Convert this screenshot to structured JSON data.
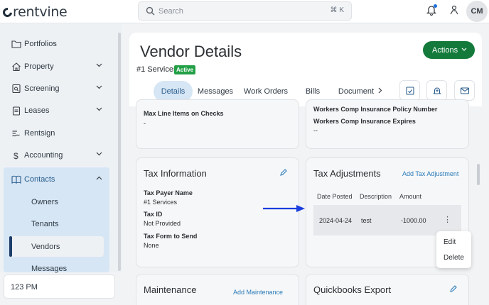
{
  "topbar": {
    "logo_text": "rentvine",
    "search_placeholder": "Search",
    "search_shortcut": "⌘ K",
    "avatar_initials": "CM",
    "icons": [
      "bell-icon",
      "user-icon"
    ],
    "notification_dot_color": "#1e6fd9"
  },
  "sidebar": {
    "items": [
      {
        "label": "Portfolios",
        "icon": "folder-icon",
        "expandable": false
      },
      {
        "label": "Property",
        "icon": "house-icon",
        "expandable": true
      },
      {
        "label": "Screening",
        "icon": "screening-icon",
        "expandable": true
      },
      {
        "label": "Leases",
        "icon": "clipboard-icon",
        "expandable": true
      },
      {
        "label": "Rentsign",
        "icon": "signature-icon",
        "expandable": false
      },
      {
        "label": "Accounting",
        "icon": "dollar-icon",
        "expandable": true
      },
      {
        "label": "Contacts",
        "icon": "book-icon",
        "expandable": true,
        "expanded": true
      }
    ],
    "contacts_sub": [
      "Owners",
      "Tenants",
      "Vendors",
      "Messages"
    ],
    "active_sub": "Vendors",
    "clock": "123 PM"
  },
  "page": {
    "title": "Vendor Details",
    "vendor_name": "#1 Services",
    "status_badge": "Active",
    "actions_label": "Actions",
    "tabs": [
      "Details",
      "Messages",
      "Work Orders",
      "Bills",
      "Document"
    ],
    "active_tab": "Details",
    "action_icons": [
      "task-icon",
      "bell-add-icon",
      "mail-icon"
    ],
    "accent": "#137a3b"
  },
  "cards": {
    "top_left": {
      "label": "Max Line Items on Checks",
      "value": "-"
    },
    "top_right": {
      "label1": "Workers Comp Insurance Policy Number",
      "label2": "Workers Comp Insurance Expires",
      "value2": "--"
    },
    "tax_info": {
      "title": "Tax Information",
      "fields": [
        {
          "label": "Tax Payer Name",
          "value": "#1 Services"
        },
        {
          "label": "Tax ID",
          "value": "Not Provided"
        },
        {
          "label": "Tax Form to Send",
          "value": "None"
        }
      ]
    },
    "tax_adjustments": {
      "title": "Tax Adjustments",
      "add_link": "Add Tax Adjustment",
      "columns": [
        "Date Posted",
        "Description",
        "Amount"
      ],
      "rows": [
        {
          "date": "2024-04-24",
          "description": "test",
          "amount": "-1000.00"
        }
      ],
      "menu": [
        "Edit",
        "Delete"
      ]
    },
    "maintenance": {
      "title": "Maintenance",
      "add_link": "Add Maintenance"
    },
    "quickbooks": {
      "title": "Quickbooks Export"
    }
  }
}
